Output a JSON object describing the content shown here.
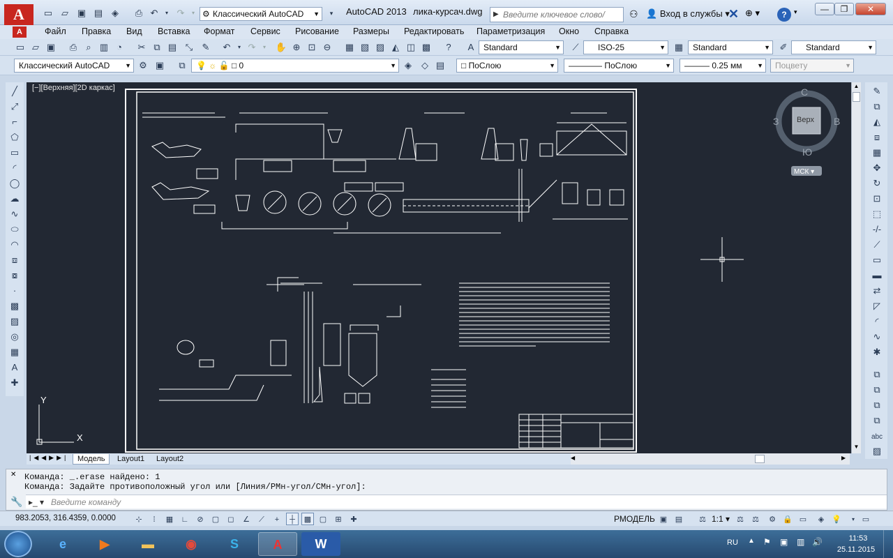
{
  "titlebar": {
    "workspace": "Классический AutoCAD",
    "app_title": "AutoCAD 2013",
    "file_title": "лика-курсач.dwg",
    "search_placeholder": "Введите ключевое слово/фразу",
    "login": "Вход в службы"
  },
  "menu": [
    "Файл",
    "Правка",
    "Вид",
    "Вставка",
    "Формат",
    "Сервис",
    "Рисование",
    "Размеры",
    "Редактировать",
    "Параметризация",
    "Окно",
    "Справка"
  ],
  "styles_toolbar": {
    "text_style": "Standard",
    "dim_style": "ISO-25",
    "table_style": "Standard",
    "mleader_style": "Standard"
  },
  "layers_toolbar": {
    "workspace": "Классический AutoCAD",
    "layer": "0",
    "color": "ПоСлою",
    "linetype": "ПоСлою",
    "lineweight": "0.25 мм",
    "plotstyle": "Поцвету"
  },
  "viewport_label": "[−][Верхняя][2D каркас]",
  "viewcube": {
    "north": "С",
    "south": "Ю",
    "west": "З",
    "east": "В",
    "face": "Верх",
    "ucs": "МСК"
  },
  "ucs_axes": {
    "y": "Y",
    "x": "X"
  },
  "layout_tabs": [
    "Модель",
    "Layout1",
    "Layout2"
  ],
  "command_history": [
    "Команда: _.erase найдено: 1",
    "Команда: Задайте противоположный угол или [Линия/РМн-угол/СМн-угол]:"
  ],
  "command_placeholder": "Введите команду",
  "status": {
    "coords": "983.2053, 316.4359, 0.0000",
    "model": "РМОДЕЛЬ",
    "scale": "1:1"
  },
  "taskbar": {
    "lang": "RU",
    "time": "11:53",
    "date": "25.11.2015"
  },
  "colors": {
    "drawing_bg": "#222833",
    "drawing_lines": "#ffffff",
    "title_bar": "#cad9ec",
    "taskbar": "#26496f"
  }
}
